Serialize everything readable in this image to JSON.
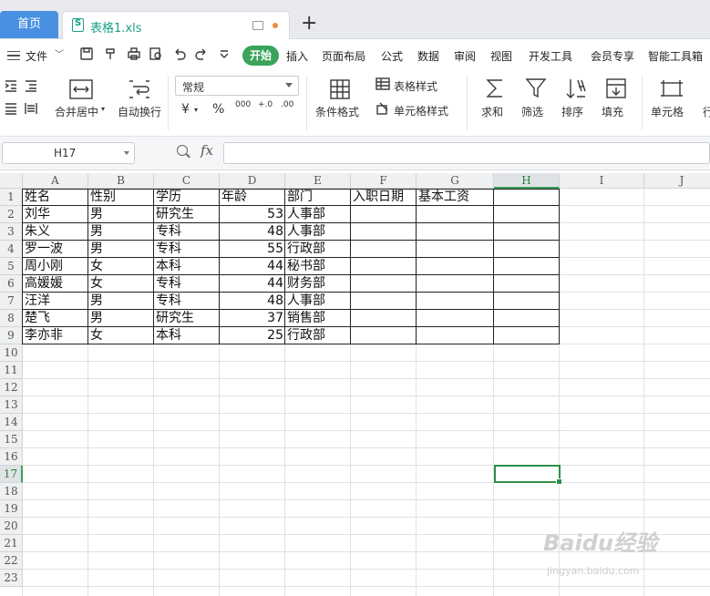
{
  "tabs": {
    "home": "首页",
    "file": "表格1.xls",
    "add": "+"
  },
  "menu": [
    "文件",
    "开始",
    "插入",
    "页面布局",
    "公式",
    "数据",
    "审阅",
    "视图",
    "开发工具",
    "会员专享",
    "智能工具箱"
  ],
  "ribbon": {
    "merge": "合并居中",
    "wrap": "自动换行",
    "number_format": "常规",
    "currency": "¥",
    "percent": "%",
    "thousands": "000",
    "dec_inc": "+.0",
    "dec_dec": ".00",
    "cond_format": "条件格式",
    "table_style": "表格样式",
    "cell_style": "单元格样式",
    "sum": "求和",
    "filter": "筛选",
    "sort": "排序",
    "fill": "填充",
    "cells": "单元格",
    "rowcol": "行"
  },
  "formula": {
    "cell_ref": "H17",
    "fx": "fx",
    "value": ""
  },
  "sheet": {
    "columns": [
      "A",
      "B",
      "C",
      "D",
      "E",
      "F",
      "G",
      "H",
      "I",
      "J"
    ],
    "selected_column": "H",
    "selected_row": "17",
    "rows": [
      "1",
      "2",
      "3",
      "4",
      "5",
      "6",
      "7",
      "8",
      "9",
      "10",
      "11",
      "12",
      "13",
      "14",
      "15",
      "16",
      "17",
      "18",
      "19",
      "20",
      "21",
      "22",
      "23"
    ],
    "header": [
      "姓名",
      "性别",
      "学历",
      "年龄",
      "部门",
      "入职日期",
      "基本工资"
    ],
    "data": [
      [
        "刘华",
        "男",
        "研究生",
        "53",
        "人事部"
      ],
      [
        "朱义",
        "男",
        "专科",
        "48",
        "人事部"
      ],
      [
        "罗一波",
        "男",
        "专科",
        "55",
        "行政部"
      ],
      [
        "周小刚",
        "女",
        "本科",
        "44",
        "秘书部"
      ],
      [
        "高媛媛",
        "女",
        "专科",
        "44",
        "财务部"
      ],
      [
        "汪洋",
        "男",
        "专科",
        "48",
        "人事部"
      ],
      [
        "楚飞",
        "男",
        "研究生",
        "37",
        "销售部"
      ],
      [
        "李亦非",
        "女",
        "本科",
        "25",
        "行政部"
      ]
    ]
  },
  "watermark": {
    "brand": "Baidu经验",
    "url": "jingyan.baidu.com"
  }
}
